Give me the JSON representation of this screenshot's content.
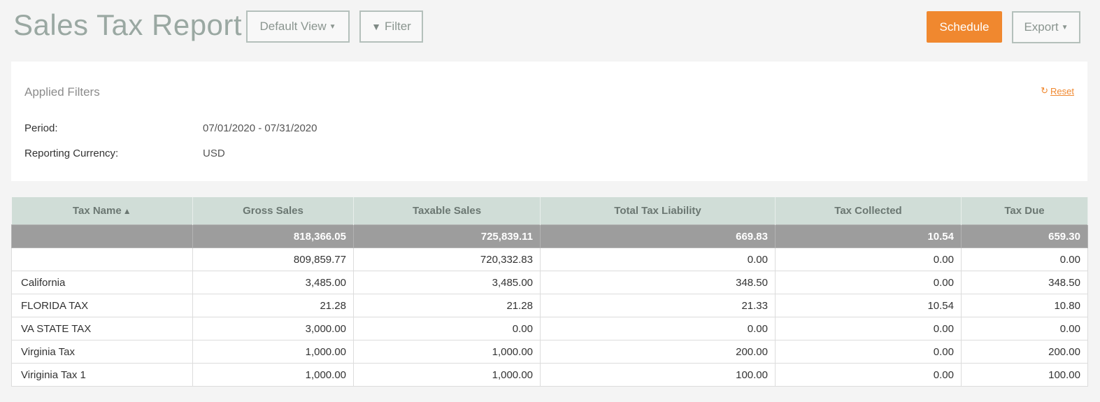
{
  "header": {
    "title": "Sales Tax Report",
    "default_view_label": "Default View",
    "filter_label": "Filter",
    "schedule_label": "Schedule",
    "export_label": "Export",
    "accent_color": "#f0882f"
  },
  "filters": {
    "title": "Applied Filters",
    "reset_label": "Reset",
    "period_label": "Period:",
    "period_value": "07/01/2020 - 07/31/2020",
    "currency_label": "Reporting Currency:",
    "currency_value": "USD"
  },
  "table": {
    "columns": [
      "Tax Name",
      "Gross Sales",
      "Taxable Sales",
      "Total Tax Liability",
      "Tax Collected",
      "Tax Due"
    ],
    "sort_indicator": "▲",
    "totals": [
      "",
      "818,366.05",
      "725,839.11",
      "669.83",
      "10.54",
      "659.30"
    ],
    "rows": [
      [
        "",
        "809,859.77",
        "720,332.83",
        "0.00",
        "0.00",
        "0.00"
      ],
      [
        "California",
        "3,485.00",
        "3,485.00",
        "348.50",
        "0.00",
        "348.50"
      ],
      [
        "FLORIDA TAX",
        "21.28",
        "21.28",
        "21.33",
        "10.54",
        "10.80"
      ],
      [
        "VA STATE TAX",
        "3,000.00",
        "0.00",
        "0.00",
        "0.00",
        "0.00"
      ],
      [
        "Virginia Tax",
        "1,000.00",
        "1,000.00",
        "200.00",
        "0.00",
        "200.00"
      ],
      [
        "Viriginia Tax 1",
        "1,000.00",
        "1,000.00",
        "100.00",
        "0.00",
        "100.00"
      ]
    ]
  }
}
